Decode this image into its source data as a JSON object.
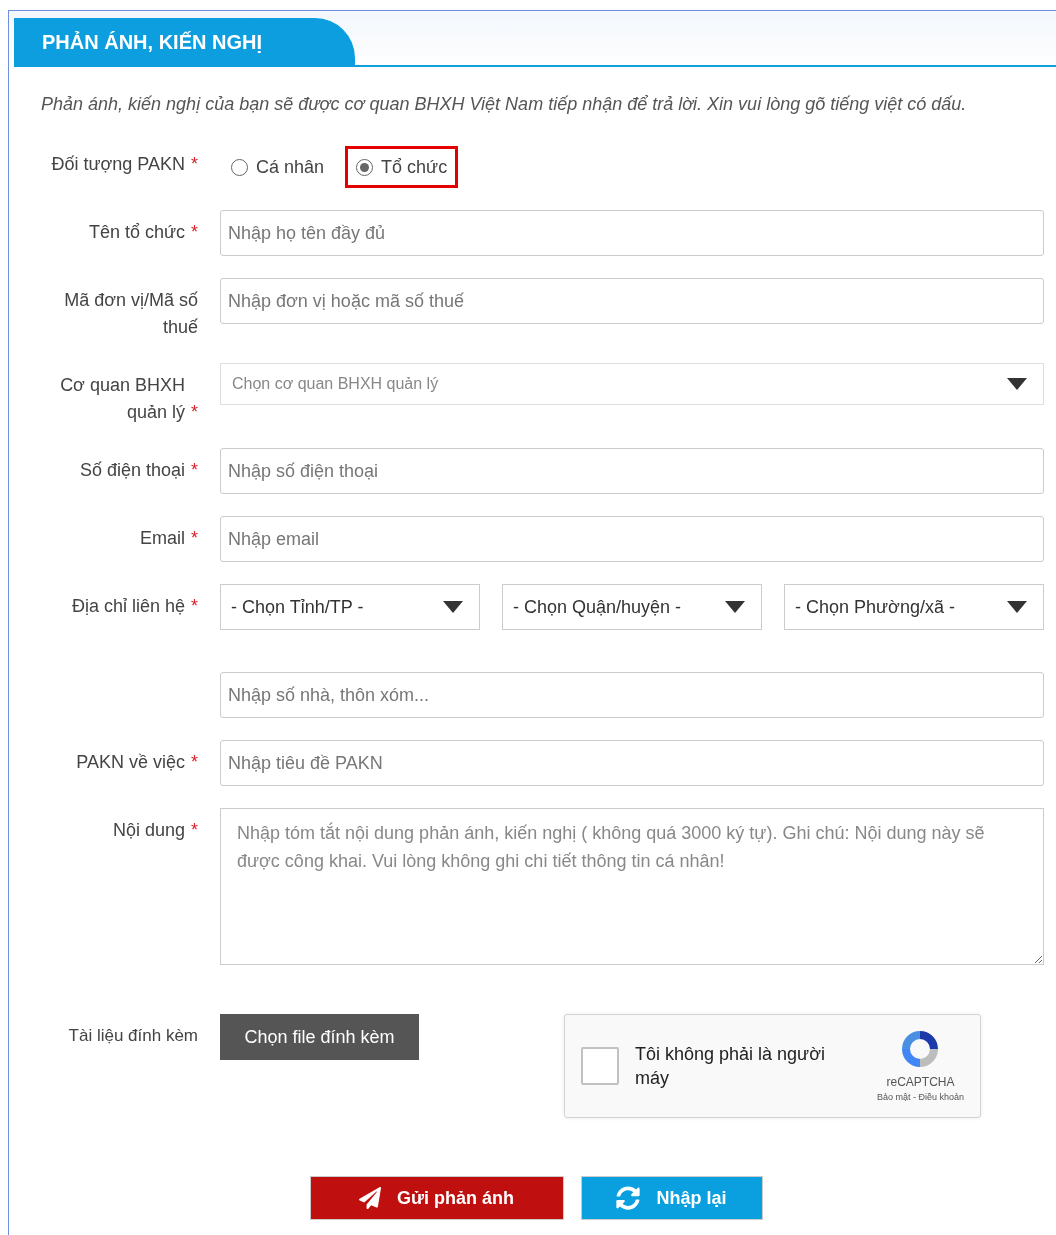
{
  "header": {
    "title": "PHẢN ÁNH, KIẾN NGHỊ"
  },
  "intro": "Phản ánh, kiến nghị của bạn sẽ được cơ quan BHXH Việt Nam tiếp nhận để trả lời. Xin vui lòng gõ tiếng việt có dấu.",
  "rows": [
    {
      "kind": "radio",
      "label": "Đối tượng PAKN",
      "mark": "*",
      "options": [
        {
          "label": "Cá nhân",
          "selected": false,
          "highlighted": false
        },
        {
          "label": "Tổ chức",
          "selected": true,
          "highlighted": true
        }
      ]
    },
    {
      "kind": "text",
      "label": "Tên tổ chức",
      "mark": "*",
      "placeholder": "Nhập họ tên đầy đủ"
    },
    {
      "kind": "text",
      "label": "Mã đơn vị/Mã số thuế",
      "placeholder": "Nhập đơn vị hoặc mã số thuế"
    },
    {
      "kind": "select",
      "label": "Cơ quan BHXH quản lý",
      "mark": "*",
      "placeholder": "Chọn cơ quan BHXH quản lý"
    },
    {
      "kind": "text",
      "label": "Số điện thoại",
      "mark": "*",
      "placeholder": "Nhập số điện thoại"
    },
    {
      "kind": "text",
      "label": "Email",
      "mark": "*",
      "placeholder": "Nhập email"
    },
    {
      "kind": "selects",
      "label": "Địa chỉ liên hệ",
      "mark": "*",
      "options": [
        "- Chọn Tỉnh/TP -",
        "- Chọn Quận/huyện -",
        "- Chọn Phường/xã -"
      ]
    },
    {
      "kind": "text",
      "placeholder": "Nhập số nhà, thôn xóm..."
    },
    {
      "kind": "text",
      "label": "PAKN về việc",
      "mark": "*",
      "placeholder": "Nhập tiêu đề PAKN"
    },
    {
      "kind": "textarea",
      "label": "Nội dung",
      "mark": "*",
      "placeholder": "Nhập tóm tắt nội dung phản ánh, kiến nghị ( không quá 3000 ký tự). Ghi chú: Nội dung này sẽ được công khai. Vui lòng không ghi chi tiết thông tin cá nhân!"
    }
  ],
  "attachment": {
    "label": "Tài liệu đính kèm",
    "button": "Chọn file đính kèm"
  },
  "captcha": {
    "checked": false,
    "text": "Tôi không phải là người máy",
    "brand": "reCAPTCHA",
    "links": "Bảo mật - Điều khoản"
  },
  "buttons": [
    {
      "kind": "submit",
      "label": "Gửi phản ánh"
    },
    {
      "kind": "reset",
      "label": "Nhập lại"
    }
  ]
}
